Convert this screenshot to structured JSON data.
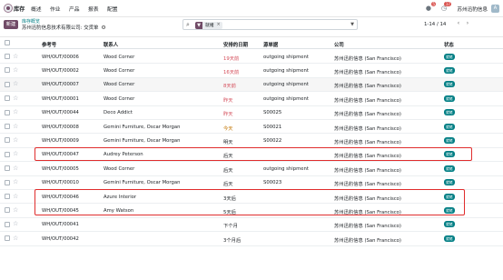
{
  "nav": {
    "app_name": "库存",
    "menus": [
      "概述",
      "作业",
      "产品",
      "报表",
      "配置"
    ],
    "badge_messages": "5",
    "badge_activities": "17",
    "company": "苏州迅豹信息"
  },
  "control": {
    "new_label": "新建",
    "breadcrumb_parent": "库存概览",
    "breadcrumb_current": "苏州迅豹信息技术有限公司: 交货单",
    "facet_label": "就绪",
    "pager": "1-14 / 14"
  },
  "table": {
    "headers": {
      "reference": "参考号",
      "contact": "联系人",
      "scheduled": "安排的日期",
      "origin": "源单据",
      "company": "公司",
      "status": "状态"
    },
    "rows": [
      {
        "ref": "WH/OUT/00006",
        "partner": "Wood Corner",
        "date": "19天前",
        "date_color": "red",
        "origin": "outgoing shipment",
        "company": "苏州迅豹信息 (San Francisco)",
        "status": "就绪"
      },
      {
        "ref": "WH/OUT/00002",
        "partner": "Wood Corner",
        "date": "16天前",
        "date_color": "red",
        "origin": "outgoing shipment",
        "company": "苏州迅豹信息 (San Francisco)",
        "status": "就绪"
      },
      {
        "ref": "WH/OUT/00007",
        "partner": "Wood Corner",
        "date": "8天前",
        "date_color": "red",
        "origin": "outgoing shipment",
        "company": "苏州迅豹信息 (San Francisco)",
        "status": "就绪"
      },
      {
        "ref": "WH/OUT/00001",
        "partner": "Wood Corner",
        "date": "昨天",
        "date_color": "red",
        "origin": "outgoing shipment",
        "company": "苏州迅豹信息 (San Francisco)",
        "status": "就绪"
      },
      {
        "ref": "WH/OUT/00044",
        "partner": "Deco Addict",
        "date": "昨天",
        "date_color": "red",
        "origin": "S00025",
        "company": "苏州迅豹信息 (San Francisco)",
        "status": "就绪"
      },
      {
        "ref": "WH/OUT/00008",
        "partner": "Gemini Furniture, Oscar Morgan",
        "date": "今天",
        "date_color": "orange",
        "origin": "S00021",
        "company": "苏州迅豹信息 (San Francisco)",
        "status": "就绪"
      },
      {
        "ref": "WH/OUT/00009",
        "partner": "Gemini Furniture, Oscar Morgan",
        "date": "明天",
        "date_color": "normal",
        "origin": "S00022",
        "company": "苏州迅豹信息 (San Francisco)",
        "status": "就绪"
      },
      {
        "ref": "WH/OUT/00047",
        "partner": "Audrey Peterson",
        "date": "后天",
        "date_color": "normal",
        "origin": "",
        "company": "苏州迅豹信息 (San Francisco)",
        "status": "就绪"
      },
      {
        "ref": "WH/OUT/00005",
        "partner": "Wood Corner",
        "date": "后天",
        "date_color": "normal",
        "origin": "outgoing shipment",
        "company": "苏州迅豹信息 (San Francisco)",
        "status": "就绪"
      },
      {
        "ref": "WH/OUT/00010",
        "partner": "Gemini Furniture, Oscar Morgan",
        "date": "后天",
        "date_color": "normal",
        "origin": "S00023",
        "company": "苏州迅豹信息 (San Francisco)",
        "status": "就绪"
      },
      {
        "ref": "WH/OUT/00046",
        "partner": "Azure Interior",
        "date": "3天后",
        "date_color": "normal",
        "origin": "",
        "company": "苏州迅豹信息 (San Francisco)",
        "status": "就绪"
      },
      {
        "ref": "WH/OUT/00045",
        "partner": "Amy Watson",
        "date": "5天后",
        "date_color": "normal",
        "origin": "",
        "company": "苏州迅豹信息 (San Francisco)",
        "status": "就绪"
      },
      {
        "ref": "WH/OUT/00041",
        "partner": "",
        "date": "下个月",
        "date_color": "normal",
        "origin": "",
        "company": "苏州迅豹信息 (San Francisco)",
        "status": "就绪"
      },
      {
        "ref": "WH/OUT/00042",
        "partner": "",
        "date": "3个月后",
        "date_color": "normal",
        "origin": "",
        "company": "苏州迅豹信息 (San Francisco)",
        "status": "就绪"
      }
    ]
  },
  "colors": {
    "brand": "#714B67",
    "status_ready": "#017e84",
    "overdue": "#d44c59",
    "today": "#c27400",
    "highlight": "#e02d2d"
  },
  "icons": [
    "app-icon",
    "chat-icon",
    "clock-icon",
    "search-icon",
    "filter-icon",
    "close-icon",
    "chevron-down-icon",
    "gear-icon",
    "star-icon",
    "chevron-left-icon",
    "chevron-right-icon"
  ]
}
